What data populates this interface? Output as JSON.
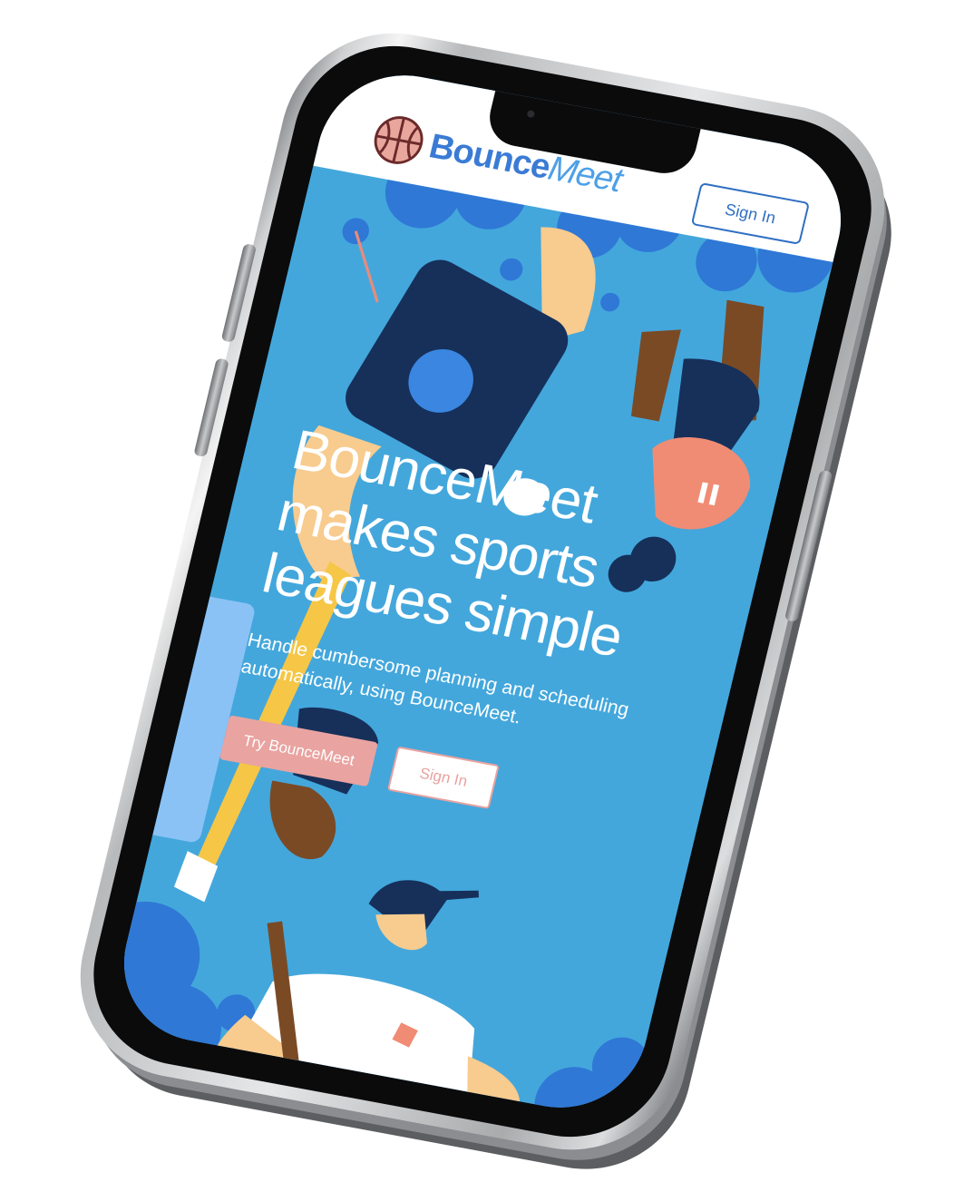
{
  "header": {
    "brand_part1": "Bounce",
    "brand_part2": "Meet",
    "sign_in_label": "Sign In"
  },
  "hero": {
    "headline_lines": [
      "BounceMeet",
      "makes sports",
      "leagues simple"
    ],
    "subtitle": "Handle cumbersome planning and scheduling automatically, using BounceMeet.",
    "try_button_label": "Try BounceMeet",
    "sign_in_label": "Sign In"
  },
  "colors": {
    "background_blue": "#43a7dc",
    "brand_blue": "#3a7bd5",
    "cta_pink": "#e9a3a0",
    "navy": "#16305a",
    "skin": "#f8cb8e"
  },
  "icons": {
    "logo": "basketball-icon"
  }
}
